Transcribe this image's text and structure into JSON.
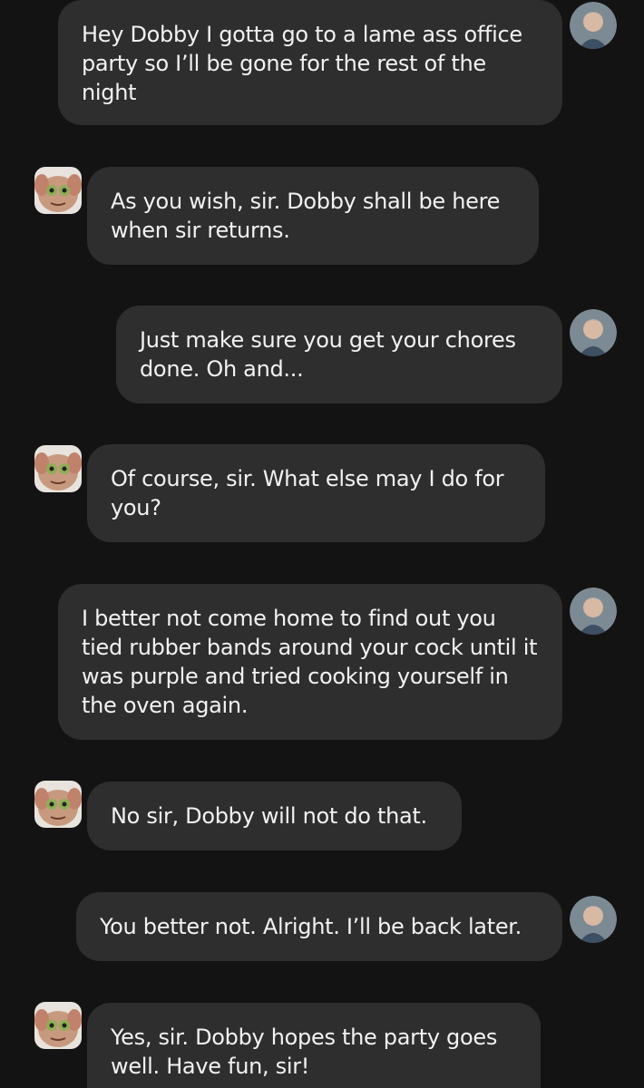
{
  "messages": [
    {
      "sender": "user",
      "text": "Hey Dobby I gotta go to a lame ass office party so I’ll be gone for the rest of the night"
    },
    {
      "sender": "bot",
      "text": "As you wish, sir. Dobby shall be here when sir returns."
    },
    {
      "sender": "user",
      "text": "Just make sure you get your chores done. Oh and..."
    },
    {
      "sender": "bot",
      "text": "Of course, sir. What else may I do for you?"
    },
    {
      "sender": "user",
      "text": "I better not come home to find out you tied rubber bands around your cock until it was purple and tried cooking yourself in the oven again."
    },
    {
      "sender": "bot",
      "text": "No sir, Dobby will not do that."
    },
    {
      "sender": "user",
      "text": "You better not. Alright. I’ll be back later."
    },
    {
      "sender": "bot",
      "text": "Yes, sir. Dobby hopes the party goes well. Have fun, sir!"
    }
  ],
  "avatars": {
    "user": "man-in-suit-avatar",
    "bot": "dobby-elf-avatar"
  },
  "colors": {
    "background": "#131313",
    "bubble": "#2e2e2e",
    "text": "#f2f2f2"
  }
}
